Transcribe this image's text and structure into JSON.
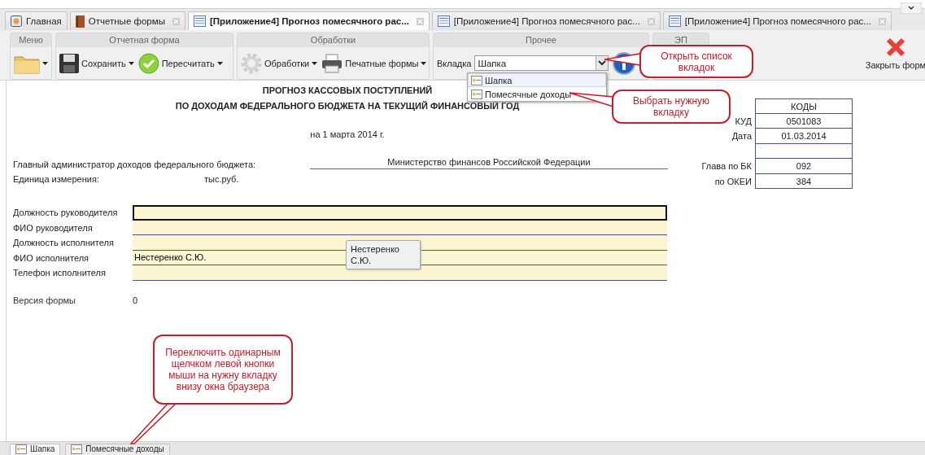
{
  "tabs": [
    {
      "label": "Главная",
      "kind": "home",
      "selected": false,
      "closable": false
    },
    {
      "label": "Отчетные формы",
      "kind": "book",
      "selected": false,
      "closable": true
    },
    {
      "label": "[Приложение4] Прогноз помесячного рас...",
      "kind": "form",
      "selected": true,
      "closable": true
    },
    {
      "label": "[Приложение4] Прогноз помесячного рас...",
      "kind": "form",
      "selected": false,
      "closable": true
    },
    {
      "label": "[Приложение4] Прогноз помесячного рас...",
      "kind": "form",
      "selected": false,
      "closable": true
    }
  ],
  "toolbar": {
    "groups": [
      {
        "title": "Меню",
        "items": [
          {
            "kind": "folder"
          }
        ]
      },
      {
        "title": "Отчетная форма",
        "items": [
          {
            "kind": "save",
            "label": "Сохранить"
          },
          {
            "kind": "check",
            "label": "Пересчитать"
          }
        ]
      },
      {
        "title": "Обработки",
        "items": [
          {
            "kind": "gear",
            "label": "Обработки"
          },
          {
            "kind": "printer",
            "label": "Печатные формы"
          }
        ]
      },
      {
        "title": "Прочее",
        "items": [
          {
            "kind": "combo",
            "label": "Вкладка",
            "value": "Шапка"
          },
          {
            "kind": "info"
          }
        ]
      },
      {
        "title": "ЭП"
      }
    ],
    "close_button": "Закрыть форм"
  },
  "dropdown": [
    {
      "label": "Шапка",
      "selected": true
    },
    {
      "label": "Помесячные доходы",
      "selected": false
    }
  ],
  "form": {
    "title_lines": [
      "ПРОГНОЗ КАССОВЫХ ПОСТУПЛЕНИЙ",
      "ПО ДОХОДАМ ФЕДЕРАЛЬНОГО БЮДЖЕТА НА ТЕКУЩИЙ ФИНАНСОВЫЙ ГОД"
    ],
    "date": "на 1 марта 2014 г.",
    "admin_label": "Главный администратор доходов федерального бюджета:",
    "admin_value": "Министерство финансов Российской Федерации",
    "unit_label": "Единица измерения:",
    "unit_value": "тыс.руб.",
    "codes": [
      {
        "kind": "header",
        "value": "КОДЫ"
      },
      {
        "kind": "code",
        "label": "КУД",
        "value": "0501083"
      },
      {
        "kind": "code",
        "label": "Дата",
        "value": "01.03.2014"
      },
      {
        "kind": "blank"
      },
      {
        "kind": "code",
        "label": "Глава по БК",
        "value": "092"
      },
      {
        "kind": "code",
        "label": "по ОКЕИ",
        "value": "384"
      }
    ],
    "fields": [
      {
        "label": "Должность руководителя",
        "focused": true
      },
      {
        "label": "ФИО руководителя",
        "focused": false
      },
      {
        "label": "Должность исполнителя",
        "focused": false
      },
      {
        "label": "ФИО исполнителя",
        "value": "Нестеренко С.Ю.",
        "focused": false
      },
      {
        "label": "Телефон исполнителя",
        "focused": false
      }
    ],
    "tooltip": [
      "Нестеренко",
      "С.Ю."
    ],
    "version_label": "Версия формы",
    "version_value": "0"
  },
  "callouts": [
    {
      "text": "Открыть список вкладок",
      "kind": "combo"
    },
    {
      "text": "Выбрать нужную вкладку",
      "kind": "item"
    },
    {
      "text": "Переключить одинарным щелчком левой кнопки мыши на нужну вкладку внизу окна браузера",
      "kind": "bottom"
    }
  ],
  "bottom_tabs": [
    {
      "label": "Шапка",
      "selected": true
    },
    {
      "label": "Помесячные доходы",
      "selected": false
    }
  ]
}
